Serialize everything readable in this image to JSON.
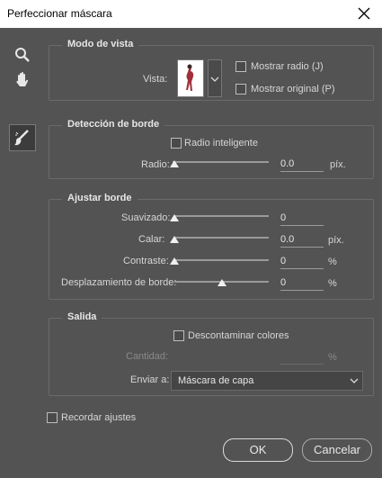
{
  "window": {
    "title": "Perfeccionar máscara"
  },
  "tools": [
    "zoom-tool",
    "hand-tool",
    "refine-radius-tool"
  ],
  "modo_vista": {
    "legend": "Modo de vista",
    "vista_label": "Vista:",
    "mostrar_radio": "Mostrar radio (J)",
    "mostrar_original": "Mostrar original (P)"
  },
  "deteccion_borde": {
    "legend": "Detección de borde",
    "radio_inteligente": "Radio inteligente",
    "radio_label": "Radio:",
    "radio_value": "0.0",
    "radio_unit": "píx."
  },
  "ajustar_borde": {
    "legend": "Ajustar borde",
    "suavizado_label": "Suavizado:",
    "suavizado_value": "0",
    "calar_label": "Calar:",
    "calar_value": "0.0",
    "calar_unit": "píx.",
    "contraste_label": "Contraste:",
    "contraste_value": "0",
    "contraste_unit": "%",
    "desplazamiento_label": "Desplazamiento de borde:",
    "desplazamiento_value": "0",
    "desplazamiento_unit": "%",
    "sliders": {
      "suavizado": 0,
      "calar": 0,
      "contraste": 0,
      "desplazamiento": 0.5
    }
  },
  "salida": {
    "legend": "Salida",
    "descontaminar": "Descontaminar colores",
    "cantidad_label": "Cantidad:",
    "cantidad_unit": "%",
    "enviar_label": "Enviar a:",
    "enviar_value": "Máscara de capa"
  },
  "footer": {
    "recordar": "Recordar ajustes",
    "ok": "OK",
    "cancel": "Cancelar"
  },
  "colors": {
    "background": "#535353",
    "titlebar": "#ffffff",
    "border": "#6a6a6a"
  }
}
